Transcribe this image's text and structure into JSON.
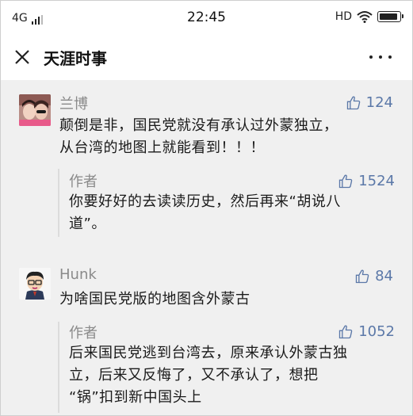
{
  "status": {
    "network": "4G",
    "time": "22:45",
    "hd": "HD"
  },
  "header": {
    "title": "天涯时事"
  },
  "comments": [
    {
      "user": "兰博",
      "likes": "124",
      "text": [
        "颠倒是非，国民党就没有承认过外蒙独立，",
        "从台湾的地图上就能看到！！！"
      ],
      "reply": {
        "user": "作者",
        "likes": "1524",
        "text": [
          "你要好好的去读读历史，然后再来“胡说八",
          "道”。"
        ]
      }
    },
    {
      "user": "Hunk",
      "likes": "84",
      "text": [
        "为啥国民党版的地图含外蒙古"
      ],
      "reply": {
        "user": "作者",
        "likes": "1052",
        "text": [
          "后来国民党逃到台湾去，原来承认外蒙古独",
          "立，后来又反悔了，又不承认了，想把",
          "“锅”扣到新中国头上"
        ]
      }
    }
  ]
}
